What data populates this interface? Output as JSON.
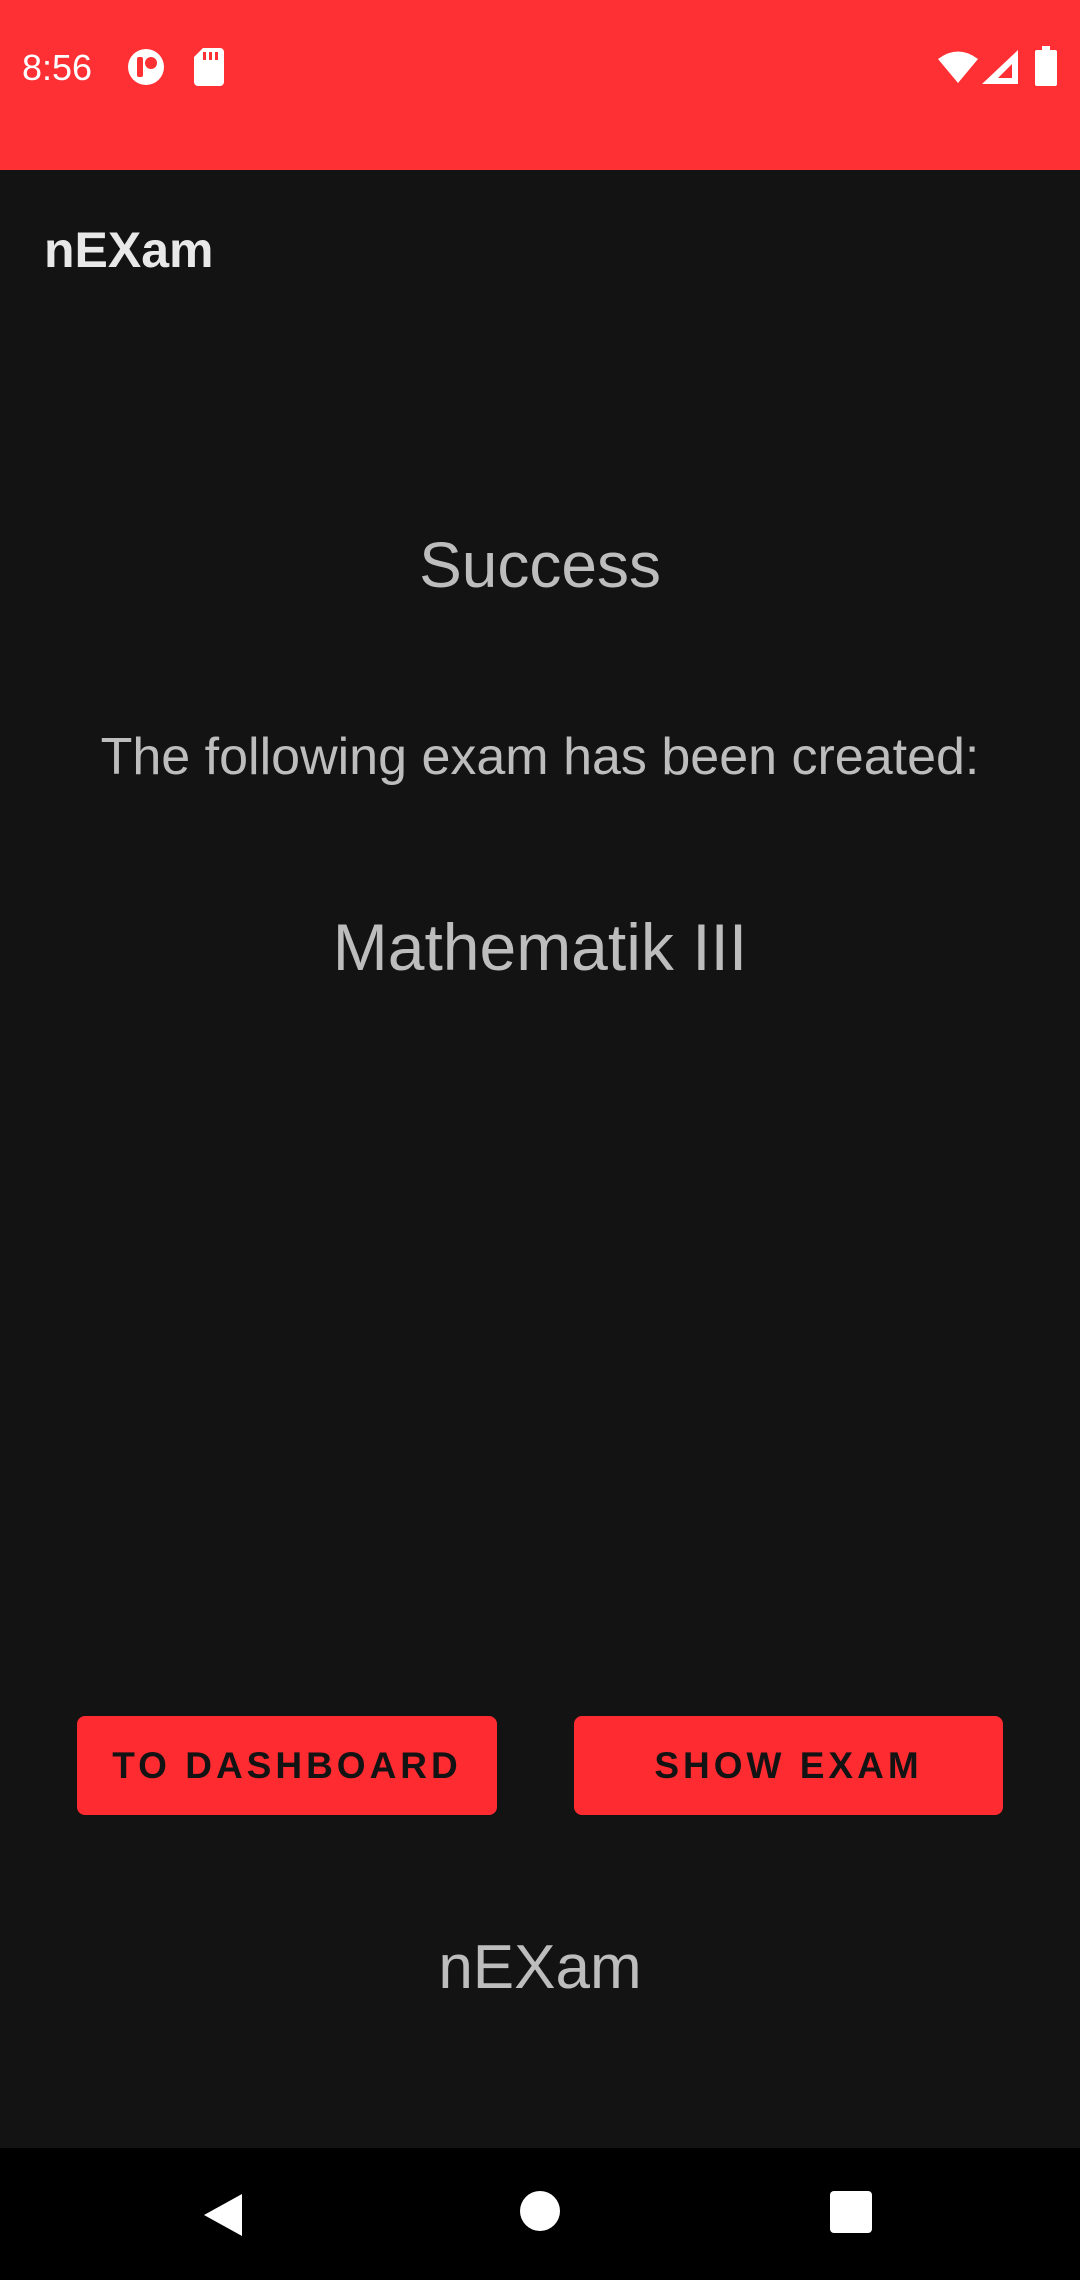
{
  "status_bar": {
    "time": "8:56",
    "background_color": "#fe3034",
    "icons": [
      "app-notification-icon",
      "sd-card-icon",
      "wifi-icon",
      "cell-signal-icon",
      "battery-icon"
    ]
  },
  "app_bar": {
    "title": "nEXam"
  },
  "content": {
    "title": "Success",
    "message": "The following exam has been created:",
    "exam_name": "Mathematik III"
  },
  "buttons": {
    "dashboard_label": "TO DASHBOARD",
    "show_exam_label": "SHOW EXAM",
    "color": "#fe2b31"
  },
  "footer": {
    "brand": "nEXam"
  },
  "nav_bar": {
    "icons": [
      "back-icon",
      "home-icon",
      "recents-icon"
    ]
  }
}
